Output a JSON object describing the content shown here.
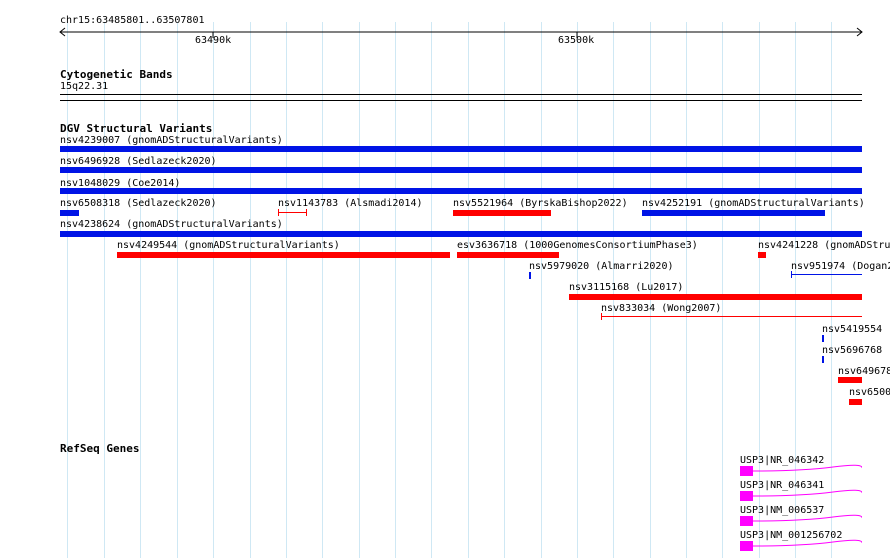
{
  "ruler": {
    "region": "chr15:63485801..63507801",
    "ticks": [
      "63490k",
      "63500k"
    ]
  },
  "cytobands": {
    "title": "Cytogenetic Bands",
    "band": "15q22.31"
  },
  "dgv": {
    "title": "DGV Structural Variants",
    "features": [
      {
        "label": "nsv4239007 (gnomADStructuralVariants)",
        "type": "loss"
      },
      {
        "label": "nsv6496928 (Sedlazeck2020)",
        "type": "loss"
      },
      {
        "label": "nsv1048029 (Coe2014)",
        "type": "loss"
      },
      {
        "label": "nsv6508318 (Sedlazeck2020)",
        "type": "loss"
      },
      {
        "label": "nsv1143783 (Alsmadi2014)",
        "type": "gain"
      },
      {
        "label": "nsv5521964 (ByrskaBishop2022)",
        "type": "gain"
      },
      {
        "label": "nsv4252191 (gnomADStructuralVariants)",
        "type": "loss"
      },
      {
        "label": "nsv4238624 (gnomADStructuralVariants)",
        "type": "loss"
      },
      {
        "label": "nsv4249544 (gnomADStructuralVariants)",
        "type": "gain"
      },
      {
        "label": "esv3636718 (1000GenomesConsortiumPhase3)",
        "type": "gain"
      },
      {
        "label": "nsv4241228 (gnomADStru",
        "type": "gain"
      },
      {
        "label": "nsv5979020 (Almarri2020)",
        "type": "loss"
      },
      {
        "label": "nsv951974 (Dogan2",
        "type": "loss"
      },
      {
        "label": "nsv3115168 (Lu2017)",
        "type": "gain"
      },
      {
        "label": "nsv833034 (Wong2007)",
        "type": "gain"
      },
      {
        "label": "nsv5419554 (",
        "type": "loss"
      },
      {
        "label": "nsv5696768 (",
        "type": "loss"
      },
      {
        "label": "nsv649678",
        "type": "gain"
      },
      {
        "label": "nsv6500",
        "type": "gain"
      }
    ]
  },
  "refseq": {
    "title": "RefSeq Genes",
    "genes": [
      {
        "label": "USP3|NR_046342"
      },
      {
        "label": "USP3|NR_046341"
      },
      {
        "label": "USP3|NM_006537"
      },
      {
        "label": "USP3|NM_001256702"
      }
    ]
  },
  "colors": {
    "loss": "#0014e6",
    "gain": "#ff0000",
    "gene": "#ff00ff",
    "grid": "#cfe8f4"
  }
}
